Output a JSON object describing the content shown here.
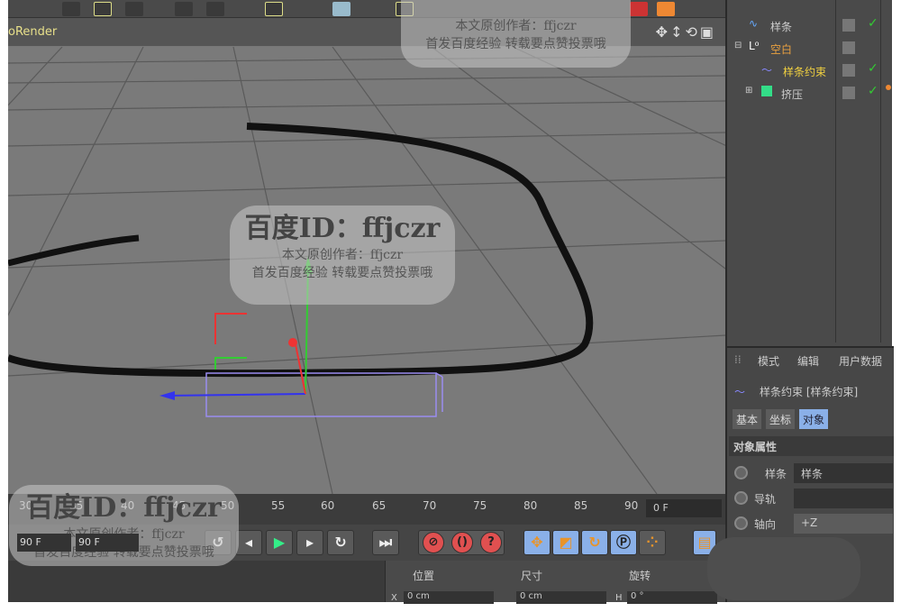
{
  "viewport": {
    "title": "oRender",
    "nav_icons": "✥↕⟲▣"
  },
  "object_manager": {
    "items": [
      {
        "label": "样条",
        "color": "#cccccc",
        "icon": "spline-icon"
      },
      {
        "label": "空白",
        "color": "#e8a040",
        "icon": "null-icon"
      },
      {
        "label": "样条约束",
        "color": "#f0d040",
        "icon": "spline-wrap-icon"
      },
      {
        "label": "挤压",
        "color": "#cccccc",
        "icon": "extrude-icon"
      }
    ]
  },
  "attributes": {
    "menu": [
      "模式",
      "编辑",
      "用户数据"
    ],
    "object_title": "样条约束 [样条约束]",
    "tabs": [
      "基本",
      "坐标",
      "对象"
    ],
    "section": "对象属性",
    "fields": [
      {
        "label": "样条",
        "value": "样条"
      },
      {
        "label": "导轨",
        "value": ""
      },
      {
        "label": "轴向",
        "value": "+Z"
      }
    ]
  },
  "timeline": {
    "ticks": [
      "30",
      "35",
      "40",
      "45",
      "50",
      "55",
      "60",
      "65",
      "70",
      "75",
      "80",
      "85",
      "90"
    ],
    "current_frame": "0 F",
    "start": "90 F",
    "end": "90 F"
  },
  "coords": {
    "headers": [
      "位置",
      "尺寸",
      "旋转"
    ],
    "x": "X",
    "x_val": "0 cm",
    "size_x": "0 cm",
    "h": "H",
    "h_val": "0 °"
  },
  "watermark": {
    "id": "百度ID：ffjczr",
    "author": "本文原创作者：ffjczr",
    "note": "首发百度经验  转载要点赞投票哦"
  },
  "accent": "#8ab0e8"
}
